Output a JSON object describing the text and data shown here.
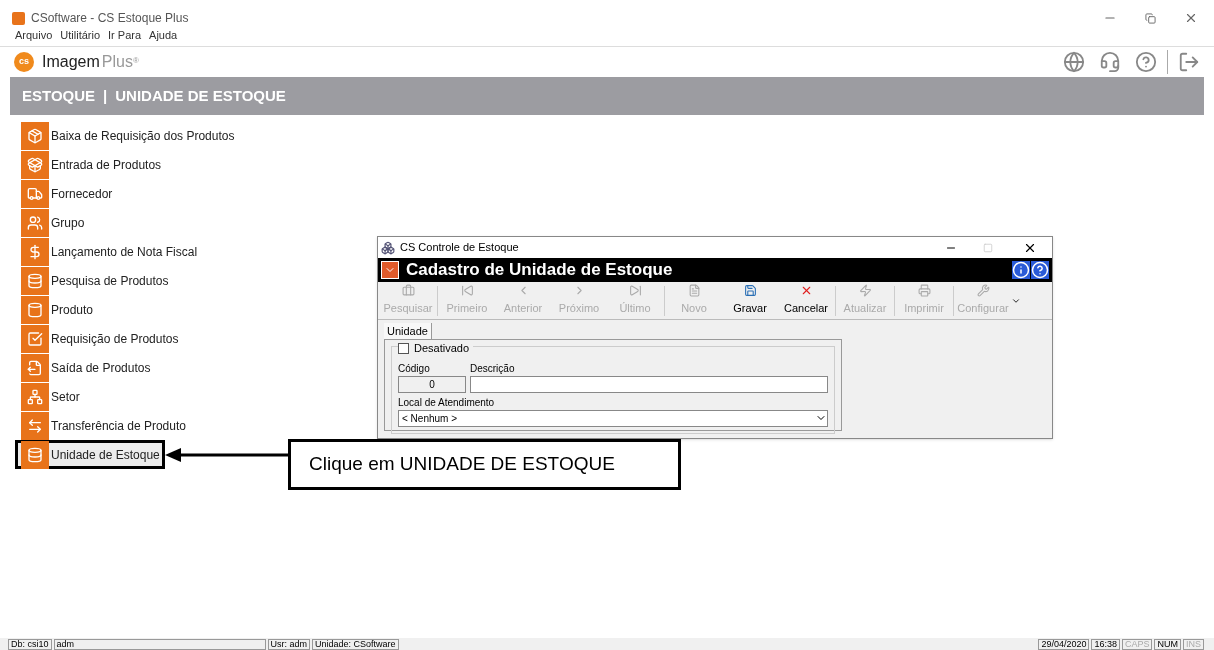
{
  "window": {
    "title": "CSoftware - CS Estoque Plus"
  },
  "menu": [
    "Arquivo",
    "Utilitário",
    "Ir Para",
    "Ajuda"
  ],
  "logo": {
    "name": "Imagem",
    "suffix": "Plus",
    "mark": "®",
    "badge": "cs"
  },
  "header": {
    "section": "ESTOQUE",
    "separator": "|",
    "page": "UNIDADE DE ESTOQUE"
  },
  "sidebar": {
    "items": [
      {
        "label": "Baixa de Requisição dos Produtos",
        "selected": false
      },
      {
        "label": "Entrada de Produtos",
        "selected": false
      },
      {
        "label": "Fornecedor",
        "selected": false
      },
      {
        "label": "Grupo",
        "selected": false
      },
      {
        "label": "Lançamento de Nota Fiscal",
        "selected": false
      },
      {
        "label": "Pesquisa de Produtos",
        "selected": false
      },
      {
        "label": "Produto",
        "selected": false
      },
      {
        "label": "Requisição de Produtos",
        "selected": false
      },
      {
        "label": "Saída de Produtos",
        "selected": false
      },
      {
        "label": "Setor",
        "selected": false
      },
      {
        "label": "Transferência de Produto",
        "selected": false
      },
      {
        "label": "Unidade de Estoque",
        "selected": true
      }
    ]
  },
  "dialog": {
    "title": "CS Controle de Estoque",
    "heading": "Cadastro de Unidade de Estoque",
    "toolbar": [
      {
        "label": "Pesquisar",
        "enabled": false
      },
      {
        "label": "Primeiro",
        "enabled": false
      },
      {
        "label": "Anterior",
        "enabled": false
      },
      {
        "label": "Próximo",
        "enabled": false
      },
      {
        "label": "Último",
        "enabled": false
      },
      {
        "label": "Novo",
        "enabled": false
      },
      {
        "label": "Gravar",
        "enabled": true
      },
      {
        "label": "Cancelar",
        "enabled": true
      },
      {
        "label": "Atualizar",
        "enabled": false
      },
      {
        "label": "Imprimir",
        "enabled": false
      },
      {
        "label": "Configurar",
        "enabled": false
      }
    ],
    "tabs": [
      {
        "label": "Unidade",
        "selected": true
      }
    ],
    "form": {
      "disabled_label": "Desativado",
      "disabled_checked": false,
      "code_label": "Código",
      "code_value": "0",
      "description_label": "Descrição",
      "location_label": "Local de Atendimento",
      "location_value": "< Nenhum >"
    }
  },
  "callout": {
    "text": "Clique em UNIDADE DE ESTOQUE"
  },
  "status_bar": {
    "left": [
      {
        "text": "Db: csi10",
        "enabled": true
      },
      {
        "text": "adm",
        "enabled": true
      },
      {
        "text": "Usr: adm",
        "enabled": true
      },
      {
        "text": "Unidade: CSoftware",
        "enabled": true
      }
    ],
    "right": [
      {
        "text": "29/04/2020",
        "enabled": true
      },
      {
        "text": "16:38",
        "enabled": true
      },
      {
        "text": "CAPS",
        "enabled": false
      },
      {
        "text": "NUM",
        "enabled": true
      },
      {
        "text": "INS",
        "enabled": false
      }
    ]
  }
}
